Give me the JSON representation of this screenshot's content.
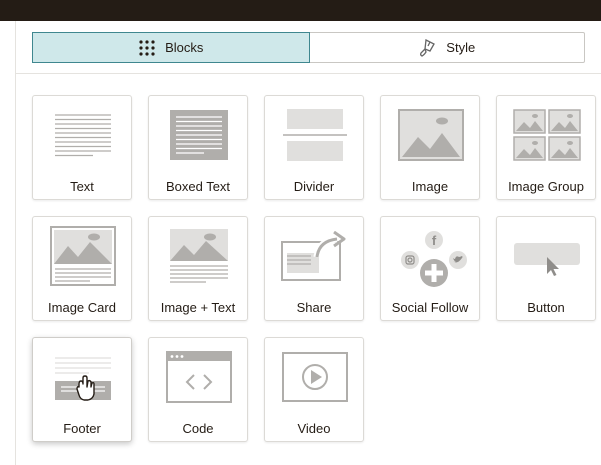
{
  "tabs": [
    {
      "label": "Blocks",
      "icon": "grid-dots-icon",
      "active": true
    },
    {
      "label": "Style",
      "icon": "paint-brush-icon",
      "active": false
    }
  ],
  "blocks": [
    {
      "label": "Text",
      "icon": "text-lines-icon"
    },
    {
      "label": "Boxed Text",
      "icon": "boxed-text-icon"
    },
    {
      "label": "Divider",
      "icon": "divider-icon"
    },
    {
      "label": "Image",
      "icon": "image-icon"
    },
    {
      "label": "Image Group",
      "icon": "image-group-icon"
    },
    {
      "label": "Image Card",
      "icon": "image-card-icon"
    },
    {
      "label": "Image + Text",
      "icon": "image-text-icon"
    },
    {
      "label": "Share",
      "icon": "share-icon"
    },
    {
      "label": "Social Follow",
      "icon": "social-follow-icon"
    },
    {
      "label": "Button",
      "icon": "button-icon"
    },
    {
      "label": "Footer",
      "icon": "footer-icon"
    },
    {
      "label": "Code",
      "icon": "code-icon"
    },
    {
      "label": "Video",
      "icon": "video-icon"
    }
  ],
  "colors": {
    "topbar": "#241c15",
    "tab_active_bg": "#cfe8ea",
    "tab_active_border": "#3f878f",
    "icon_gray": "#b0aeab",
    "icon_light": "#e0dfdd"
  }
}
